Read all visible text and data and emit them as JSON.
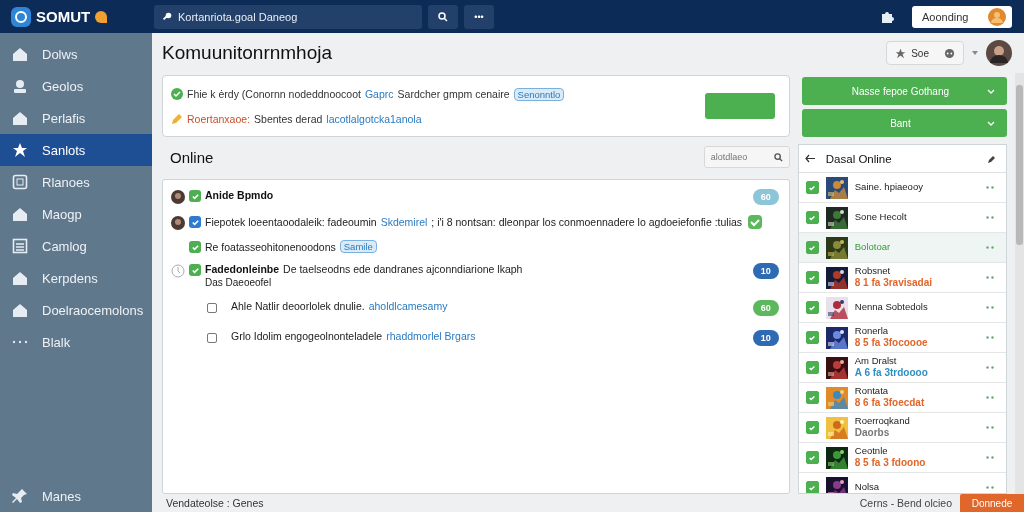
{
  "topbar": {
    "logo": "SOMUT",
    "search": {
      "value": "Kortanriota.goal Daneog"
    },
    "more": "•••",
    "account": "Aoonding"
  },
  "sidebar": {
    "items": [
      {
        "label": "Dolws",
        "selected": false
      },
      {
        "label": "Geolos",
        "selected": false
      },
      {
        "label": "Perlafis",
        "selected": false
      },
      {
        "label": "Sanlots",
        "selected": true
      },
      {
        "label": "Rlanoes",
        "selected": false
      },
      {
        "label": "Maogp",
        "selected": false
      },
      {
        "label": "Camlog",
        "selected": false
      },
      {
        "label": "Kerpdens",
        "selected": false
      },
      {
        "label": "Doelraocemolons",
        "selected": false
      },
      {
        "label": "Blalk",
        "selected": false
      }
    ],
    "footer_item": "Manes"
  },
  "page": {
    "title": "Komuunitonrnmhoja",
    "pill": "Soe"
  },
  "notice": {
    "lines": [
      {
        "kind": "ok",
        "text": "Fhie k ėrdy (Conornn nodeddnoocoot",
        "link": "Gaprc",
        "after": "Sardcher gmpm cenaire",
        "tag": "Senonntlo"
      },
      {
        "kind": "warn",
        "label": "Roertanxaoe:",
        "text": "Sbentes derad",
        "link": "lacotlalgotcka1anola"
      }
    ]
  },
  "actions": [
    {
      "label": "Nasse fepoe Gothang"
    },
    {
      "label": "Bant"
    }
  ],
  "online": {
    "title": "Online",
    "search": {
      "placeholder": "alotdlaeo"
    },
    "tasks": [
      {
        "kind": "avatar",
        "checked": true,
        "color": "#4caf50",
        "title": "Anide Bpmdo",
        "badge": {
          "text": "60",
          "color": "#8cc4d8"
        }
      },
      {
        "kind": "avatar",
        "checked": true,
        "color": "#2e7bd0",
        "text": "Fiepotek loeentaoodaleik: fadeoumin",
        "link": "Skdemirel",
        "after": "; i'i 8 nontsan: dleonpar los conmoennadere lo agdoeiefonfie :tulias",
        "done": true,
        "children": [
          {
            "checked": true,
            "color": "#4caf50",
            "text": "Re foatasseohitonenoodons",
            "tag": "Samile"
          }
        ]
      },
      {
        "kind": "clock",
        "checked": true,
        "color": "#4caf50",
        "title": "Fadedonleinbe",
        "text": "De taelseodns ede dandranes ajconndiarione lkaph",
        "sub": "Das Daeoeofel",
        "badge": {
          "text": "10",
          "color": "#2f6bb3"
        },
        "children": [
          {
            "checked": false,
            "text": "Ahle Natlir deoorlolek dnulie.",
            "link": "aholdlcamesamy",
            "badge": {
              "text": "60",
              "color": "#5cb85c"
            }
          },
          {
            "checked": false,
            "text": "Grlo Idolim engogeolnonteladele",
            "link": "rhaddmorlel Brgars",
            "badge": {
              "text": "10",
              "color": "#2f6bb3"
            }
          }
        ]
      }
    ]
  },
  "panel": {
    "title": "Dasal Online",
    "rows": [
      {
        "name": "Saine. hpiaeooy",
        "checked": true,
        "selected": false
      },
      {
        "name": "Sone Hecolt",
        "checked": true,
        "selected": false
      },
      {
        "name": "Bolotoar",
        "checked": true,
        "selected": true
      },
      {
        "name": "Robsnet",
        "sub": "8 1 fa 3ravisadai",
        "color": "#e0662a",
        "checked": true,
        "selected": false
      },
      {
        "name": "Nenna Sobtedols",
        "checked": true,
        "selected": false
      },
      {
        "name": "Ronerla",
        "sub": "8 5 fa 3focoooe",
        "color": "#e0662a",
        "checked": true,
        "selected": false
      },
      {
        "name": "Am Dralst",
        "sub": "A 6 fa 3trdoooo",
        "color": "#2e8fc0",
        "checked": true,
        "selected": false
      },
      {
        "name": "Rontata",
        "sub": "8 6 fa 3foecdat",
        "color": "#e0662a",
        "checked": true,
        "selected": false
      },
      {
        "name": "Roerroqkand",
        "sub": "Daorbs",
        "color": "#777777",
        "checked": true,
        "selected": false
      },
      {
        "name": "Ceotnle",
        "sub": "8 5 fa 3 fdoono",
        "color": "#e0662a",
        "checked": true,
        "selected": false
      },
      {
        "name": "Nolsa",
        "checked": true,
        "selected": false
      }
    ]
  },
  "footer": {
    "left": "Vendateolse : Genes",
    "right": "Cerns - Bend olcieo",
    "button": "Donnede"
  }
}
